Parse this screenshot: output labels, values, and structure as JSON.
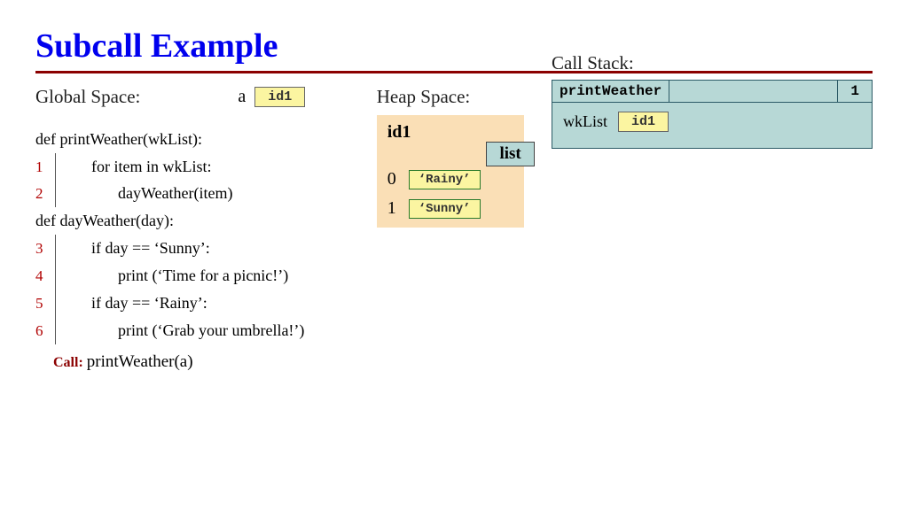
{
  "title": "Subcall Example",
  "global": {
    "label": "Global Space:",
    "var": "a",
    "ref": "id1"
  },
  "code": {
    "def1": "def printWeather(wkList):",
    "l1": "for item in wkList:",
    "l2": "dayWeather(item)",
    "def2": "def dayWeather(day):",
    "l3": "if day == ‘Sunny’:",
    "l4": "print (‘Time for a picnic!’)",
    "l5": "if day == ‘Rainy’:",
    "l6": "print (‘Grab your umbrella!’)",
    "call_label": "Call:",
    "call_expr": "printWeather(a)",
    "n1": "1",
    "n2": "2",
    "n3": "3",
    "n4": "4",
    "n5": "5",
    "n6": "6"
  },
  "heap": {
    "label": "Heap Space:",
    "id": "id1",
    "type": "list",
    "rows": [
      {
        "idx": "0",
        "val": "‘Rainy’"
      },
      {
        "idx": "1",
        "val": "‘Sunny’"
      }
    ]
  },
  "stack": {
    "label": "Call Stack:",
    "frame_name": "printWeather",
    "frame_line": "1",
    "var": "wkList",
    "ref": "id1"
  }
}
